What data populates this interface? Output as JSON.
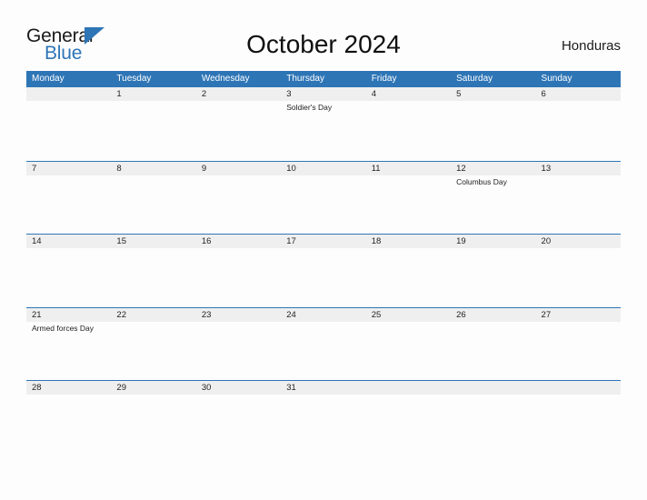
{
  "brand": {
    "name_part1": "General",
    "name_part2": "Blue"
  },
  "header": {
    "title": "October 2024",
    "country": "Honduras"
  },
  "calendar": {
    "weekdays": [
      "Monday",
      "Tuesday",
      "Wednesday",
      "Thursday",
      "Friday",
      "Saturday",
      "Sunday"
    ],
    "accent_color": "#2E75B6",
    "band_color": "#efefef",
    "weeks": [
      [
        {
          "day": ""
        },
        {
          "day": "1"
        },
        {
          "day": "2"
        },
        {
          "day": "3",
          "event": "Soldier's Day"
        },
        {
          "day": "4"
        },
        {
          "day": "5"
        },
        {
          "day": "6"
        }
      ],
      [
        {
          "day": "7"
        },
        {
          "day": "8"
        },
        {
          "day": "9"
        },
        {
          "day": "10"
        },
        {
          "day": "11"
        },
        {
          "day": "12",
          "event": "Columbus Day"
        },
        {
          "day": "13"
        }
      ],
      [
        {
          "day": "14"
        },
        {
          "day": "15"
        },
        {
          "day": "16"
        },
        {
          "day": "17"
        },
        {
          "day": "18"
        },
        {
          "day": "19"
        },
        {
          "day": "20"
        }
      ],
      [
        {
          "day": "21",
          "event": "Armed forces Day"
        },
        {
          "day": "22"
        },
        {
          "day": "23"
        },
        {
          "day": "24"
        },
        {
          "day": "25"
        },
        {
          "day": "26"
        },
        {
          "day": "27"
        }
      ],
      [
        {
          "day": "28"
        },
        {
          "day": "29"
        },
        {
          "day": "30"
        },
        {
          "day": "31"
        },
        {
          "day": ""
        },
        {
          "day": ""
        },
        {
          "day": ""
        }
      ]
    ]
  }
}
